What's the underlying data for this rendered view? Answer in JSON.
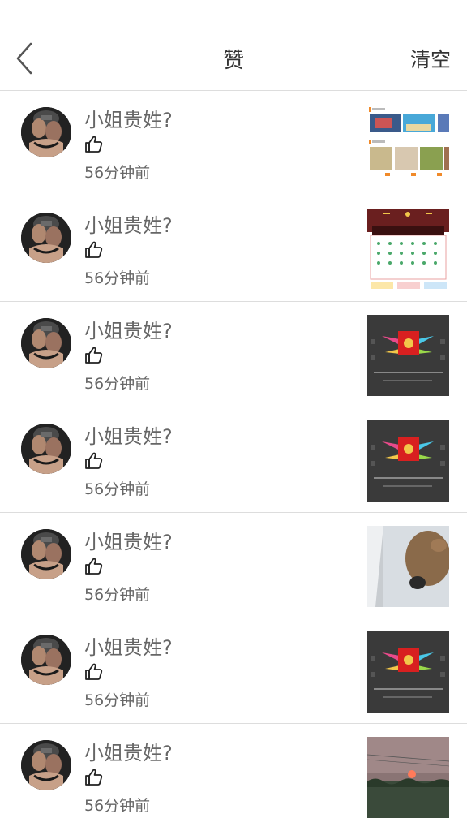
{
  "header": {
    "title": "赞",
    "clear_label": "清空"
  },
  "items": [
    {
      "name": "小姐贵姓?",
      "time": "56分钟前",
      "thumb": "app-screenshot"
    },
    {
      "name": "小姐贵姓?",
      "time": "56分钟前",
      "thumb": "checkin-calendar"
    },
    {
      "name": "小姐贵姓?",
      "time": "56分钟前",
      "thumb": "red-envelope"
    },
    {
      "name": "小姐贵姓?",
      "time": "56分钟前",
      "thumb": "red-envelope"
    },
    {
      "name": "小姐贵姓?",
      "time": "56分钟前",
      "thumb": "dog-photo"
    },
    {
      "name": "小姐贵姓?",
      "time": "56分钟前",
      "thumb": "red-envelope"
    },
    {
      "name": "小姐贵姓?",
      "time": "56分钟前",
      "thumb": "sunset-photo"
    }
  ]
}
